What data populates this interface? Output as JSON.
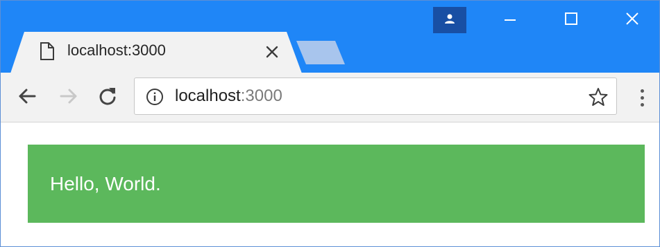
{
  "browser": {
    "tab": {
      "title": "localhost:3000",
      "page_icon": "page-icon",
      "close_icon": "close-icon"
    },
    "window_controls": {
      "profile_icon": "person-icon",
      "minimize_icon": "minimize-icon",
      "maximize_icon": "maximize-icon",
      "close_icon": "close-icon"
    },
    "toolbar": {
      "back_icon": "arrow-left-icon",
      "forward_icon": "arrow-right-icon",
      "reload_icon": "reload-icon",
      "info_icon": "info-icon",
      "url_host": "localhost",
      "url_port": ":3000",
      "bookmark_icon": "star-icon",
      "menu_icon": "more-vertical-icon"
    },
    "colors": {
      "titlebar": "#1f86f7",
      "tab_active": "#f2f2f2",
      "tab_inactive": "#a8c5ed"
    }
  },
  "page": {
    "alert_text": "Hello, World.",
    "alert_color": "#5cb85c"
  }
}
